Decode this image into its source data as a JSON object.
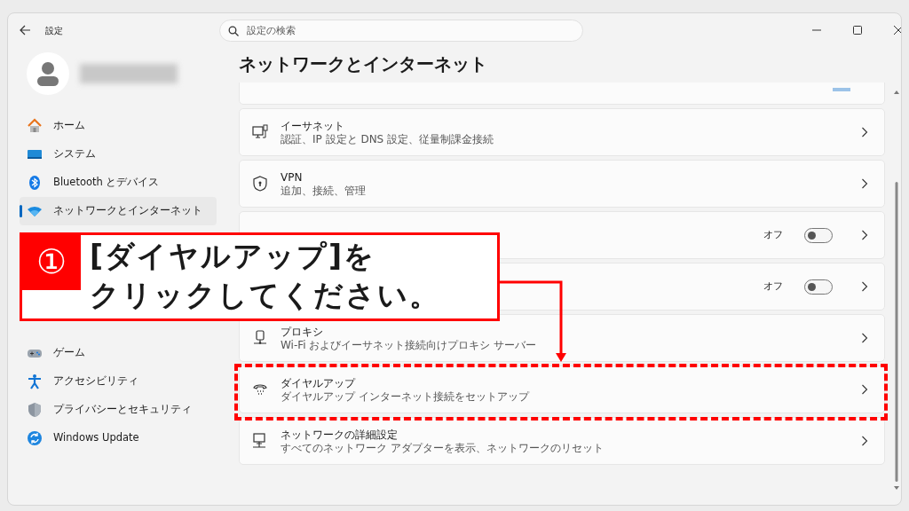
{
  "window": {
    "title": "設定"
  },
  "search": {
    "placeholder": "設定の検索"
  },
  "sidebar": {
    "items": [
      {
        "kind": "home",
        "label": "ホーム",
        "selected": false
      },
      {
        "kind": "system",
        "label": "システム",
        "selected": false
      },
      {
        "kind": "bluetooth",
        "label": "Bluetooth とデバイス",
        "selected": false
      },
      {
        "kind": "network",
        "label": "ネットワークとインターネット",
        "selected": true
      }
    ],
    "items_below": [
      {
        "kind": "game",
        "label": "ゲーム",
        "selected": false
      },
      {
        "kind": "accessibility",
        "label": "アクセシビリティ",
        "selected": false
      },
      {
        "kind": "privacy",
        "label": "プライバシーとセキュリティ",
        "selected": false
      },
      {
        "kind": "update",
        "label": "Windows Update",
        "selected": false
      }
    ]
  },
  "page": {
    "title": "ネットワークとインターネット"
  },
  "settings": [
    {
      "kind": "partial",
      "toggle": {
        "on": true
      }
    },
    {
      "kind": "ethernet",
      "title": "イーサネット",
      "subtitle": "認証、IP 設定と DNS 設定、従量制課金接続"
    },
    {
      "kind": "vpn",
      "title": "VPN",
      "subtitle": "追加、接続、管理"
    },
    {
      "kind": "covered",
      "toggle": {
        "label": "オフ",
        "on": false
      }
    },
    {
      "kind": "covered",
      "toggle": {
        "label": "オフ",
        "on": false
      }
    },
    {
      "kind": "proxy",
      "title": "プロキシ",
      "subtitle": "Wi-Fi およびイーサネット接続向けプロキシ サーバー"
    },
    {
      "kind": "dialup",
      "title": "ダイヤルアップ",
      "subtitle": "ダイヤルアップ インターネット接続をセットアップ"
    },
    {
      "kind": "advanced",
      "title": "ネットワークの詳細設定",
      "subtitle": "すべてのネットワーク アダプターを表示、ネットワークのリセット"
    }
  ],
  "callout": {
    "number": "①",
    "lines": [
      "[ダイヤルアップ]を",
      "クリックしてください。"
    ]
  }
}
